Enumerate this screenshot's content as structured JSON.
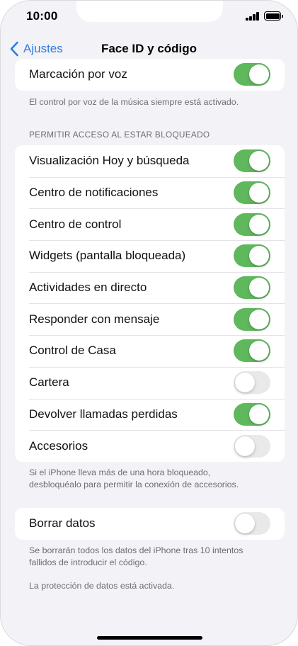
{
  "status_bar": {
    "time": "10:00"
  },
  "nav": {
    "back_label": "Ajustes",
    "title": "Face ID y código"
  },
  "voice_group": {
    "rows": [
      {
        "label": "Marcación por voz",
        "on": true
      }
    ],
    "footer": "El control por voz de la música siempre está activado."
  },
  "locked_access": {
    "header": "PERMITIR ACCESO AL ESTAR BLOQUEADO",
    "rows": [
      {
        "label": "Visualización Hoy y búsqueda",
        "on": true
      },
      {
        "label": "Centro de notificaciones",
        "on": true
      },
      {
        "label": "Centro de control",
        "on": true
      },
      {
        "label": "Widgets (pantalla bloqueada)",
        "on": true
      },
      {
        "label": "Actividades en directo",
        "on": true
      },
      {
        "label": "Responder con mensaje",
        "on": true
      },
      {
        "label": "Control de Casa",
        "on": true
      },
      {
        "label": "Cartera",
        "on": false
      },
      {
        "label": "Devolver llamadas perdidas",
        "on": true
      },
      {
        "label": "Accesorios",
        "on": false
      }
    ],
    "footer_line1": "Si el iPhone lleva más de una hora bloqueado,",
    "footer_line2": "desbloquéalo para permitir la conexión de accesorios."
  },
  "erase_group": {
    "rows": [
      {
        "label": "Borrar datos",
        "on": false
      }
    ],
    "footer_line1": "Se borrarán todos los datos del iPhone tras 10 intentos",
    "footer_line2": "fallidos de introducir el código.",
    "protection_note": "La protección de datos está activada."
  },
  "colors": {
    "accent": "#2f7de1",
    "toggle_on": "#5fb85c",
    "toggle_off": "#e9e9ea",
    "background": "#f2f2f7"
  },
  "icons": {
    "back": "chevron-left-icon",
    "signal": "cellular-signal-icon",
    "battery": "battery-icon"
  }
}
